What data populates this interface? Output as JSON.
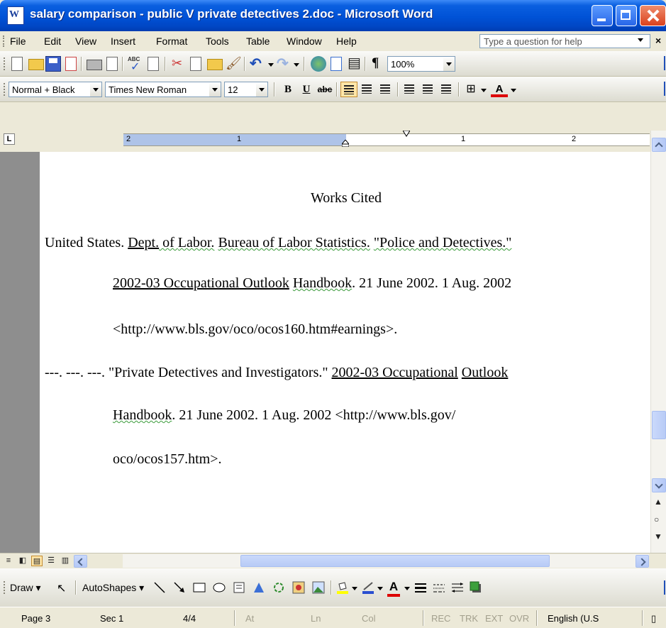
{
  "window": {
    "title": "salary comparison - public V private detectives 2.doc - Microsoft Word"
  },
  "menu": {
    "items": [
      "File",
      "Edit",
      "View",
      "Insert",
      "Format",
      "Tools",
      "Table",
      "Window",
      "Help"
    ],
    "help_placeholder": "Type a question for help",
    "doc_close": "×"
  },
  "standard_toolbar": {
    "zoom": "100%"
  },
  "formatting_toolbar": {
    "style": "Normal + Black",
    "font": "Times New Roman",
    "size": "12",
    "bold": "B",
    "underline": "U",
    "strike": "abc",
    "font_color_label": "A",
    "active_alignment": "align-left"
  },
  "ruler": {
    "numbers": [
      "2",
      "1",
      "1",
      "2"
    ]
  },
  "document": {
    "heading": "Works Cited",
    "entries": [
      {
        "line1_prefix": "United States. ",
        "line1_a": "Dept.",
        "line1_b": " of ",
        "line1_c": "Labor.",
        "line1_d": " ",
        "line1_e": "Bureau of Labor Statistics.",
        "line1_f": " ",
        "line1_g": "\"Police and Detectives.\"",
        "line2_title": "2002-03 Occupational Outlook",
        "line2_space": " ",
        "line2_handbook": "Handbook",
        "line2_rest": ".  21 June 2002. 1 Aug. 2002",
        "line3": "<http://www.bls.gov/oco/ocos160.htm#earnings>."
      },
      {
        "line1_prefix": "---. ---. ---. \"Private Detectives and Investigators.\" ",
        "line1_title": "2002-03 Occupational",
        "line1_space": " ",
        "line1_outlook": "Outlook",
        "line2_handbook": "Handbook",
        "line2_rest": ". 21 June 2002. 1 Aug. 2002 <http://www.bls.gov/",
        "line3": "oco/ocos157.htm>."
      }
    ]
  },
  "draw_toolbar": {
    "draw": "Draw",
    "autoshapes": "AutoShapes",
    "font_color_label": "A"
  },
  "status": {
    "page": "Page 3",
    "sec": "Sec 1",
    "pages": "4/4",
    "at": "At",
    "ln": "Ln",
    "col": "Col",
    "rec": "REC",
    "trk": "TRK",
    "ext": "EXT",
    "ovr": "OVR",
    "language": "English (U.S"
  },
  "colors": {
    "titlebar": "#0052d6",
    "ruler_margin": "#aec3e8",
    "active_button": "#ffe6a8",
    "grammar_underline": "#3a9a3a"
  }
}
